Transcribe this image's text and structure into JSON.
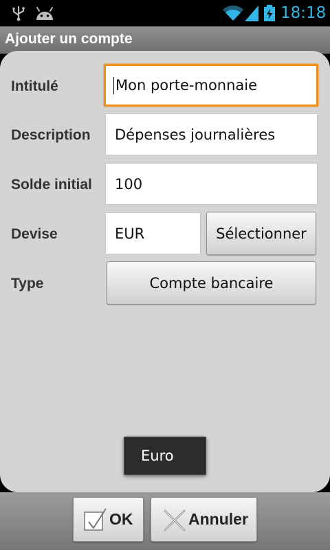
{
  "status_bar": {
    "time": "18:18",
    "icons": [
      "usb-icon",
      "android-debug-icon",
      "wifi-icon",
      "signal-icon",
      "battery-charging-icon"
    ],
    "clock_color": "#33b5e5"
  },
  "window": {
    "title": "Ajouter un compte"
  },
  "form": {
    "intitule": {
      "label": "Intitulé",
      "value": "Mon porte-monnaie"
    },
    "description": {
      "label": "Description",
      "value": "Dépenses journalières"
    },
    "solde_initial": {
      "label": "Solde initial",
      "value": "100"
    },
    "devise": {
      "label": "Devise",
      "value": "EUR",
      "select_label": "Sélectionner"
    },
    "type": {
      "label": "Type",
      "value": "Compte bancaire"
    }
  },
  "toast": {
    "text": "Euro"
  },
  "actions": {
    "ok_label": "OK",
    "cancel_label": "Annuler"
  },
  "colors": {
    "focus": "#f0901c",
    "panel": "#d4d4d4"
  }
}
